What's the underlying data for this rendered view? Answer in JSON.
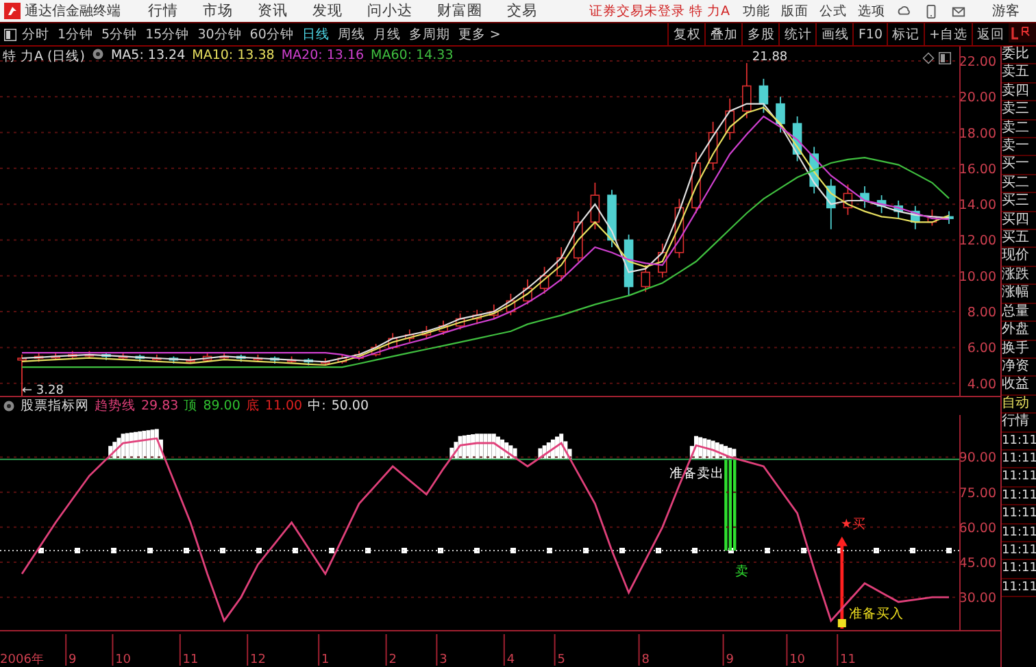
{
  "titlebar": {
    "app_name": "通达信金融终端",
    "menu": [
      "行情",
      "市场",
      "资讯",
      "发现",
      "问小达",
      "财富圈",
      "交易"
    ],
    "status": "证券交易未登录  特 力A",
    "right_menu": [
      "功能",
      "版面",
      "公式",
      "选项"
    ],
    "user": "游客"
  },
  "toolbar": {
    "periods": [
      {
        "label": "分时",
        "selected": false
      },
      {
        "label": "1分钟",
        "selected": false
      },
      {
        "label": "5分钟",
        "selected": false
      },
      {
        "label": "15分钟",
        "selected": false
      },
      {
        "label": "30分钟",
        "selected": false
      },
      {
        "label": "60分钟",
        "selected": false
      },
      {
        "label": "日线",
        "selected": true
      },
      {
        "label": "周线",
        "selected": false
      },
      {
        "label": "月线",
        "selected": false
      },
      {
        "label": "多周期",
        "selected": false
      },
      {
        "label": "更多 >",
        "selected": false
      }
    ],
    "actions": [
      "复权",
      "叠加",
      "多股",
      "统计",
      "画线",
      "F10",
      "标记",
      "+自选",
      "返回"
    ]
  },
  "price_chart": {
    "title": "特 力A (日线)",
    "ma_values": [
      ": 13.24",
      ": 13.38",
      ": 13.16",
      ": 14.33"
    ],
    "chart_data": {
      "type": "candlestick",
      "ylim": [
        3.3,
        22.8
      ],
      "grid": true,
      "categories": [
        null,
        null,
        null,
        null,
        null,
        null,
        null,
        null,
        null,
        null,
        null,
        null,
        null,
        null,
        null,
        null,
        null,
        null,
        null,
        null,
        null,
        null,
        null,
        null,
        null,
        null,
        null,
        null,
        null,
        null,
        null,
        null,
        null,
        null,
        null,
        null,
        null,
        null,
        null,
        null,
        null,
        null,
        null,
        null,
        null,
        null,
        null,
        null,
        null,
        null,
        null,
        null,
        null,
        null,
        null,
        null
      ],
      "yticks": [
        {
          "value": 4,
          "label": "4.00"
        },
        {
          "value": 6,
          "label": "6.00"
        },
        {
          "value": 8,
          "label": "8.00"
        },
        {
          "value": 10,
          "label": "10.00"
        },
        {
          "value": 12,
          "label": "12.00"
        },
        {
          "value": 14,
          "label": "14.00"
        },
        {
          "value": 16,
          "label": "16.00"
        },
        {
          "value": 18,
          "label": "18.00"
        },
        {
          "value": 20,
          "label": "20.00"
        },
        {
          "value": 22,
          "label": "22.00"
        }
      ],
      "ohlc": [
        [
          5.3,
          5.6,
          3.28,
          5.4
        ],
        [
          5.4,
          5.7,
          5.2,
          5.5
        ],
        [
          5.5,
          5.7,
          5.3,
          5.5
        ],
        [
          5.5,
          5.8,
          5.4,
          5.6
        ],
        [
          5.6,
          5.8,
          5.4,
          5.6
        ],
        [
          5.6,
          5.7,
          5.3,
          5.5
        ],
        [
          5.5,
          5.7,
          5.3,
          5.5
        ],
        [
          5.5,
          5.6,
          5.2,
          5.4
        ],
        [
          5.4,
          5.6,
          5.2,
          5.4
        ],
        [
          5.4,
          5.5,
          5.1,
          5.3
        ],
        [
          5.3,
          5.5,
          5.1,
          5.3
        ],
        [
          5.3,
          5.7,
          5.2,
          5.5
        ],
        [
          5.5,
          5.7,
          5.3,
          5.5
        ],
        [
          5.5,
          5.6,
          5.2,
          5.4
        ],
        [
          5.4,
          5.6,
          5.2,
          5.4
        ],
        [
          5.4,
          5.5,
          5.1,
          5.3
        ],
        [
          5.3,
          5.5,
          5.1,
          5.3
        ],
        [
          5.3,
          5.4,
          5.0,
          5.2
        ],
        [
          5.2,
          5.4,
          5.0,
          5.2
        ],
        [
          5.2,
          5.6,
          5.1,
          5.4
        ],
        [
          5.4,
          5.8,
          5.3,
          5.6
        ],
        [
          5.6,
          6.2,
          5.5,
          6.0
        ],
        [
          6.0,
          6.8,
          5.9,
          6.5
        ],
        [
          6.5,
          7.0,
          6.3,
          6.7
        ],
        [
          6.7,
          7.2,
          6.5,
          6.9
        ],
        [
          6.9,
          7.5,
          6.7,
          7.2
        ],
        [
          7.2,
          7.9,
          7.0,
          7.6
        ],
        [
          7.6,
          8.1,
          7.3,
          7.8
        ],
        [
          7.8,
          8.4,
          7.6,
          8.0
        ],
        [
          8.0,
          9.0,
          7.8,
          8.6
        ],
        [
          8.6,
          9.8,
          8.4,
          9.3
        ],
        [
          9.3,
          10.5,
          9.0,
          10.0
        ],
        [
          10.0,
          11.6,
          9.7,
          11.0
        ],
        [
          11.0,
          13.6,
          10.8,
          13.0
        ],
        [
          13.0,
          15.2,
          12.6,
          14.5
        ],
        [
          14.5,
          14.8,
          11.6,
          12.0
        ],
        [
          12.0,
          12.3,
          8.9,
          9.4
        ],
        [
          9.4,
          10.6,
          9.1,
          10.2
        ],
        [
          10.2,
          11.8,
          9.9,
          11.3
        ],
        [
          11.3,
          14.3,
          11.0,
          13.8
        ],
        [
          13.8,
          16.9,
          13.5,
          16.3
        ],
        [
          16.3,
          18.6,
          15.9,
          18.0
        ],
        [
          18.0,
          19.9,
          17.6,
          19.2
        ],
        [
          19.2,
          21.88,
          18.8,
          20.6
        ],
        [
          20.6,
          21.0,
          19.1,
          19.6
        ],
        [
          19.6,
          20.0,
          18.0,
          18.5
        ],
        [
          18.5,
          18.9,
          16.4,
          16.8
        ],
        [
          16.8,
          17.2,
          14.6,
          15.0
        ],
        [
          15.0,
          15.4,
          12.6,
          13.8
        ],
        [
          13.8,
          15.1,
          13.4,
          14.6
        ],
        [
          14.6,
          15.0,
          13.8,
          14.2
        ],
        [
          14.2,
          14.5,
          13.5,
          13.9
        ],
        [
          13.9,
          14.2,
          13.2,
          13.6
        ],
        [
          13.6,
          13.9,
          12.6,
          13.0
        ],
        [
          13.0,
          13.7,
          12.8,
          13.3
        ],
        [
          13.3,
          13.6,
          12.9,
          13.2
        ]
      ],
      "series": [
        {
          "name": "MA5",
          "type": "line",
          "color": "#e0e0e0",
          "values": [
            5.4,
            5.45,
            5.5,
            5.55,
            5.6,
            5.55,
            5.5,
            5.45,
            5.4,
            5.35,
            5.3,
            5.4,
            5.5,
            5.45,
            5.4,
            5.35,
            5.3,
            5.25,
            5.2,
            5.4,
            5.6,
            6.0,
            6.5,
            6.7,
            6.9,
            7.2,
            7.6,
            7.8,
            8.0,
            8.6,
            9.3,
            10.1,
            11.0,
            12.8,
            14.0,
            12.5,
            10.2,
            10.4,
            11.3,
            13.6,
            16.3,
            17.8,
            19.2,
            19.6,
            19.6,
            18.4,
            16.8,
            15.2,
            14.0,
            14.2,
            14.2,
            13.9,
            13.6,
            13.4,
            13.3,
            13.24
          ]
        },
        {
          "name": "MA10",
          "type": "line",
          "color": "#e8e060",
          "values": [
            5.22,
            5.27,
            5.32,
            5.37,
            5.42,
            5.37,
            5.32,
            5.27,
            5.22,
            5.17,
            5.12,
            5.22,
            5.32,
            5.27,
            5.22,
            5.17,
            5.12,
            5.07,
            5.02,
            5.22,
            5.5,
            5.9,
            6.3,
            6.55,
            6.8,
            7.1,
            7.4,
            7.65,
            7.9,
            8.4,
            9.0,
            9.8,
            10.6,
            12.0,
            13.0,
            12.0,
            10.8,
            10.5,
            10.8,
            12.8,
            15.0,
            16.8,
            18.3,
            19.1,
            19.4,
            18.5,
            17.2,
            15.8,
            14.6,
            14.0,
            13.6,
            13.3,
            13.2,
            13.0,
            13.0,
            13.38
          ]
        },
        {
          "name": "MA20",
          "type": "line",
          "color": "#d040d0",
          "values": [
            5.7,
            5.7,
            5.7,
            5.7,
            5.7,
            5.7,
            5.7,
            5.7,
            5.7,
            5.7,
            5.7,
            5.7,
            5.7,
            5.7,
            5.7,
            5.7,
            5.7,
            5.7,
            5.7,
            5.6,
            5.4,
            5.7,
            6.0,
            6.25,
            6.5,
            6.8,
            7.1,
            7.35,
            7.6,
            8.0,
            8.5,
            9.1,
            9.8,
            10.7,
            11.6,
            11.3,
            10.9,
            10.7,
            10.6,
            12.0,
            13.6,
            15.2,
            16.8,
            17.9,
            18.9,
            18.3,
            17.6,
            16.6,
            15.6,
            14.9,
            14.2,
            14.0,
            13.8,
            13.5,
            13.2,
            13.16
          ]
        },
        {
          "name": "MA60",
          "type": "line",
          "color": "#40c040",
          "values": [
            4.9,
            4.9,
            4.9,
            4.9,
            4.9,
            4.9,
            4.9,
            4.9,
            4.9,
            4.9,
            4.9,
            4.9,
            4.9,
            4.9,
            4.9,
            4.9,
            4.9,
            4.9,
            4.9,
            4.9,
            5.1,
            5.3,
            5.5,
            5.7,
            5.9,
            6.1,
            6.3,
            6.5,
            6.7,
            6.9,
            7.3,
            7.55,
            7.8,
            8.1,
            8.4,
            8.65,
            8.9,
            9.25,
            9.6,
            10.2,
            10.8,
            11.7,
            12.6,
            13.5,
            14.3,
            14.9,
            15.5,
            15.9,
            16.3,
            16.5,
            16.6,
            16.4,
            16.2,
            15.7,
            15.2,
            14.33
          ]
        }
      ],
      "annotations": [
        "21.88",
        "← 3.28"
      ]
    }
  },
  "indicator": {
    "name": "股票指标网",
    "legend": [
      {
        "kind": "text",
        "text": "29.83",
        "color": "#e0407a"
      },
      {
        "kind": "text",
        "text": "顶",
        "color": "#30c030"
      },
      {
        "kind": "ref_top",
        "color": "#30c030"
      },
      {
        "kind": "text",
        "text": "底",
        "color": "#e02020"
      },
      {
        "kind": "text",
        "text": "11.00",
        "color": "#e02020"
      },
      {
        "kind": "text",
        "text": "中:",
        "color": "#e0e0e0"
      },
      {
        "kind": "ref_mid",
        "color": "#e0e0e0"
      }
    ],
    "signals": [
      {
        "kind": "sell",
        "label": "准备卖出",
        "mark": "卖"
      },
      {
        "kind": "buy",
        "label": "准备买入",
        "mark": "★买"
      }
    ],
    "chart_data": {
      "type": "line",
      "ylim": [
        16,
        108
      ],
      "grid": true,
      "categories": [
        "2006年",
        null,
        null,
        "9",
        null,
        null,
        "10",
        null,
        null,
        null,
        "11",
        null,
        null,
        null,
        "12",
        null,
        null,
        null,
        "1",
        null,
        null,
        null,
        "2",
        null,
        null,
        "3",
        null,
        null,
        null,
        "4",
        null,
        null,
        "5",
        null,
        null,
        null,
        null,
        "8",
        null,
        null,
        null,
        null,
        "9",
        null,
        null,
        null,
        "10",
        null,
        null,
        "11",
        null,
        null,
        null,
        null,
        null,
        null
      ],
      "yticks": [
        {
          "value": 30,
          "label": "30.00"
        },
        {
          "value": 45,
          "label": "45.00"
        },
        {
          "value": 60,
          "label": "60.00"
        },
        {
          "value": 75,
          "label": "75.00"
        },
        {
          "value": 90,
          "label": "90.00"
        }
      ],
      "series": [
        {
          "name": "趋势线",
          "color": "#e0407a",
          "values": [
            40,
            51,
            62,
            72,
            82,
            89,
            96,
            97,
            98,
            80,
            62,
            40,
            20,
            30,
            44,
            53,
            62,
            51,
            40,
            55,
            70,
            78,
            86,
            80,
            74,
            85,
            95,
            96,
            96,
            91,
            86,
            91,
            96,
            83,
            70,
            50,
            32,
            46,
            60,
            78,
            95,
            93,
            90,
            88,
            86,
            76,
            66,
            42,
            20,
            28,
            36,
            32,
            28,
            29,
            30,
            30
          ]
        }
      ],
      "ref_lines": [
        {
          "axis": "y",
          "value": 89,
          "label": "89.00"
        },
        {
          "axis": "y",
          "value": 50,
          "label": "50.00"
        }
      ]
    }
  },
  "side_panel": {
    "items": [
      {
        "text": "委比",
        "kind": "label"
      },
      {
        "text": "卖五",
        "kind": "label"
      },
      {
        "text": "卖四",
        "kind": "label"
      },
      {
        "text": "卖三",
        "kind": "label"
      },
      {
        "text": "卖二",
        "kind": "label"
      },
      {
        "text": "卖一",
        "kind": "label"
      },
      {
        "text": "买一",
        "kind": "label"
      },
      {
        "text": "买二",
        "kind": "label"
      },
      {
        "text": "买三",
        "kind": "label"
      },
      {
        "text": "买四",
        "kind": "label"
      },
      {
        "text": "买五",
        "kind": "label"
      },
      {
        "text": "现价",
        "kind": "label"
      },
      {
        "text": "涨跌",
        "kind": "label"
      },
      {
        "text": "涨幅",
        "kind": "label"
      },
      {
        "text": "总量",
        "kind": "label"
      },
      {
        "text": "外盘",
        "kind": "label"
      },
      {
        "text": "换手",
        "kind": "label"
      },
      {
        "text": "净资",
        "kind": "label"
      },
      {
        "text": "收益",
        "kind": "label"
      },
      {
        "text": "自动",
        "kind": "mode"
      },
      {
        "text": "行情",
        "kind": "label"
      },
      {
        "text": "11:11",
        "kind": "time"
      },
      {
        "text": "11:11",
        "kind": "time"
      },
      {
        "text": "11:11",
        "kind": "time"
      },
      {
        "text": "11:11",
        "kind": "time"
      },
      {
        "text": "11:11",
        "kind": "time"
      },
      {
        "text": "11:11",
        "kind": "time"
      },
      {
        "text": "11:11",
        "kind": "time"
      },
      {
        "text": "11:11",
        "kind": "time"
      },
      {
        "text": "11:11",
        "kind": "time"
      }
    ]
  }
}
